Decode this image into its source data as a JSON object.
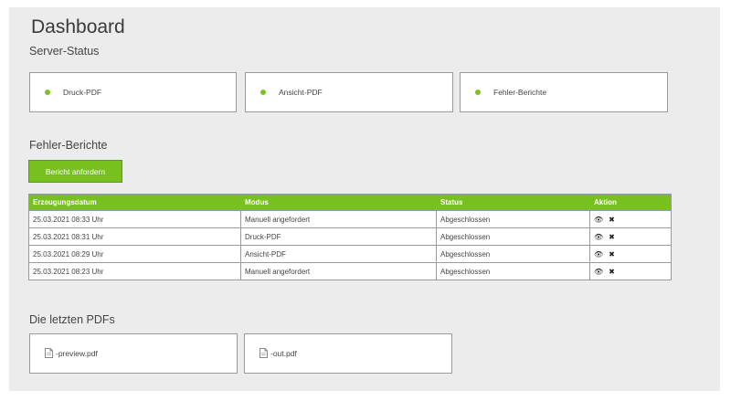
{
  "header": {
    "title": "Dashboard"
  },
  "server_status": {
    "label": "Server-Status",
    "items": [
      {
        "label": "Druck-PDF",
        "status_color": "#7bc11f"
      },
      {
        "label": "Ansicht-PDF",
        "status_color": "#7bc11f"
      },
      {
        "label": "Fehler-Berichte",
        "status_color": "#7bc11f"
      }
    ]
  },
  "error_reports": {
    "label": "Fehler-Berichte",
    "request_button": "Bericht anfordern",
    "columns": [
      "Erzeugungsdatum",
      "Modus",
      "Status",
      "Aktion"
    ],
    "rows": [
      {
        "date": "25.03.2021 08:33 Uhr",
        "mode": "Manuell angefordert",
        "status": "Abgeschlossen"
      },
      {
        "date": "25.03.2021 08:31 Uhr",
        "mode": "Druck-PDF",
        "status": "Abgeschlossen"
      },
      {
        "date": "25.03.2021 08:29 Uhr",
        "mode": "Ansicht-PDF",
        "status": "Abgeschlossen"
      },
      {
        "date": "25.03.2021 08:23 Uhr",
        "mode": "Manuell angefordert",
        "status": "Abgeschlossen"
      }
    ],
    "actions": {
      "view_glyph": "👁",
      "delete_glyph": "✖"
    }
  },
  "recent_pdfs": {
    "label": "Die letzten PDFs",
    "files": [
      {
        "name": "-preview.pdf"
      },
      {
        "name": "-out.pdf"
      }
    ]
  },
  "colors": {
    "accent": "#77c01e",
    "status_ok": "#7bc11f",
    "panel_bg": "#ececec"
  }
}
